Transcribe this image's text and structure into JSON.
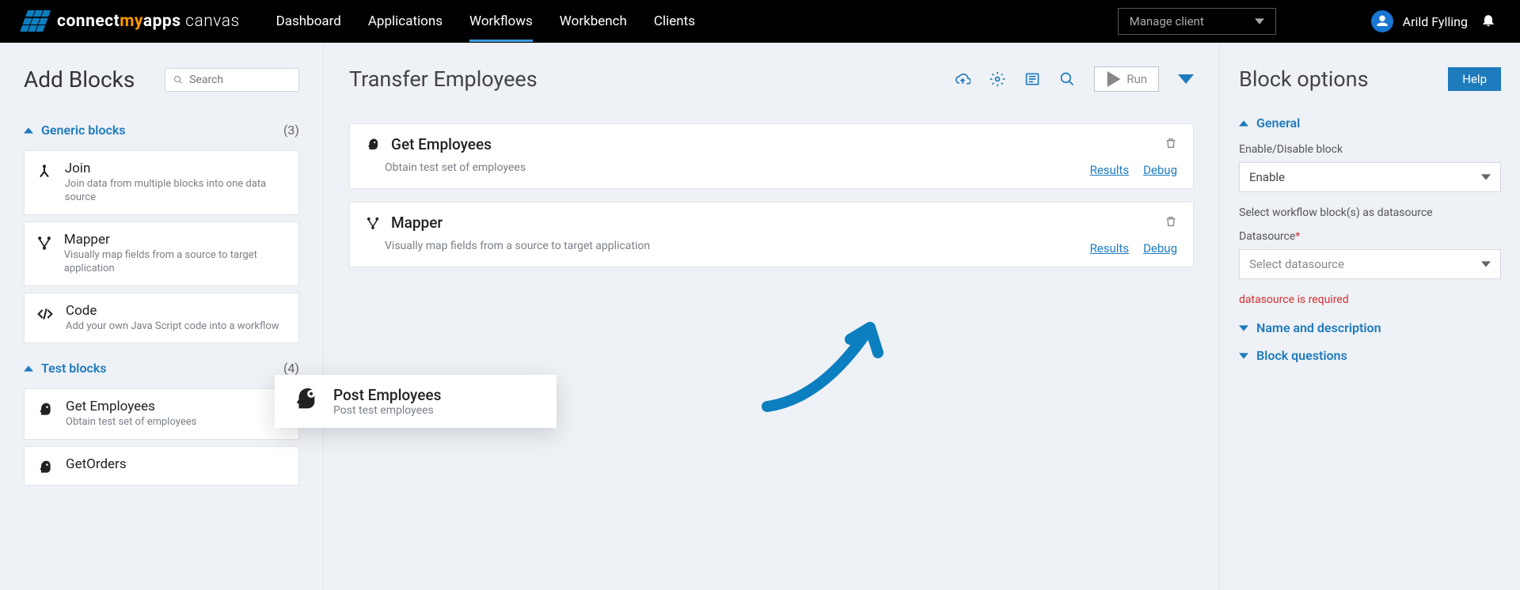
{
  "header": {
    "brand_parts": [
      "connect",
      "my",
      "apps",
      " canvas"
    ],
    "nav": [
      "Dashboard",
      "Applications",
      "Workflows",
      "Workbench",
      "Clients"
    ],
    "active_nav": "Workflows",
    "client_placeholder": "Manage client",
    "user_name": "Arild Fylling"
  },
  "left": {
    "title": "Add Blocks",
    "search_placeholder": "Search",
    "categories": [
      {
        "name": "Generic blocks",
        "count": "(3)",
        "open": true,
        "items": [
          {
            "icon": "join",
            "title": "Join",
            "desc": "Join data from multiple blocks into one data source"
          },
          {
            "icon": "mapper",
            "title": "Mapper",
            "desc": "Visually map fields from a source to target application"
          },
          {
            "icon": "code",
            "title": "Code",
            "desc": "Add your own Java Script code into a workflow"
          }
        ]
      },
      {
        "name": "Test blocks",
        "count": "(4)",
        "open": true,
        "items": [
          {
            "icon": "head",
            "title": "Get Employees",
            "desc": "Obtain test set of employees"
          },
          {
            "icon": "head",
            "title": "GetOrders",
            "desc": ""
          }
        ]
      }
    ]
  },
  "center": {
    "title": "Transfer Employees",
    "run_label": "Run",
    "blocks": [
      {
        "icon": "head",
        "title": "Get Employees",
        "desc": "Obtain test set of employees",
        "results": "Results",
        "debug": "Debug"
      },
      {
        "icon": "mapper",
        "title": "Mapper",
        "desc": "Visually map fields from a source to target application",
        "results": "Results",
        "debug": "Debug"
      }
    ],
    "dragging": {
      "title": "Post Employees",
      "desc": "Post test employees"
    }
  },
  "right": {
    "title": "Block options",
    "help": "Help",
    "general": "General",
    "enable_label": "Enable/Disable block",
    "enable_value": "Enable",
    "ds_hint": "Select workflow block(s) as datasource",
    "ds_label": "Datasource",
    "ds_placeholder": "Select datasource",
    "ds_error": "datasource is required",
    "name_section": "Name and description",
    "questions_section": "Block questions"
  }
}
